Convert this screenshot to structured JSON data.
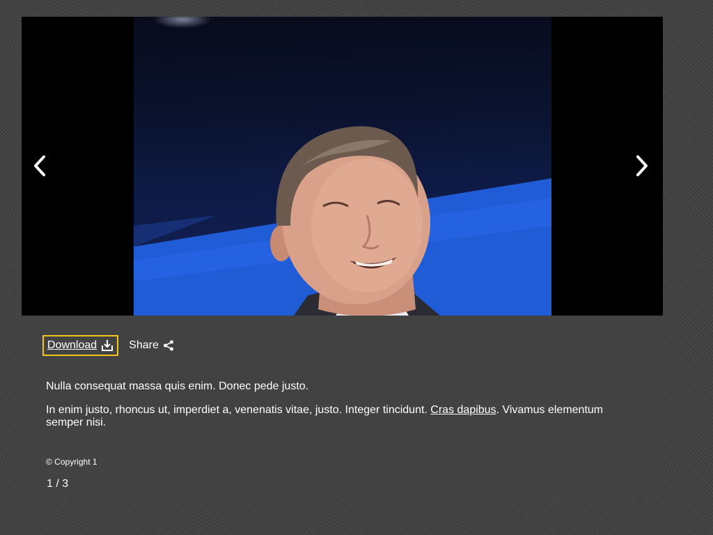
{
  "viewer": {
    "prev_icon": "chevron-left-icon",
    "next_icon": "chevron-right-icon",
    "accent_focus_color": "#f5c518",
    "stage_color": "#000000",
    "panel_color": "#424242"
  },
  "actions": {
    "download_label": "Download",
    "download_icon": "download-icon",
    "share_label": "Share",
    "share_icon": "share-icon"
  },
  "caption": {
    "line1": "Nulla consequat massa quis enim. Donec pede justo.",
    "line2_before": "In enim justo, rhoncus ut, imperdiet a, venenatis vitae, justo. Integer tincidunt. ",
    "line2_link": "Cras dapibus",
    "line2_after": ". Vivamus elementum semper nisi."
  },
  "copyright": "© Copyright 1",
  "pagination": {
    "text": "1 / 3"
  }
}
